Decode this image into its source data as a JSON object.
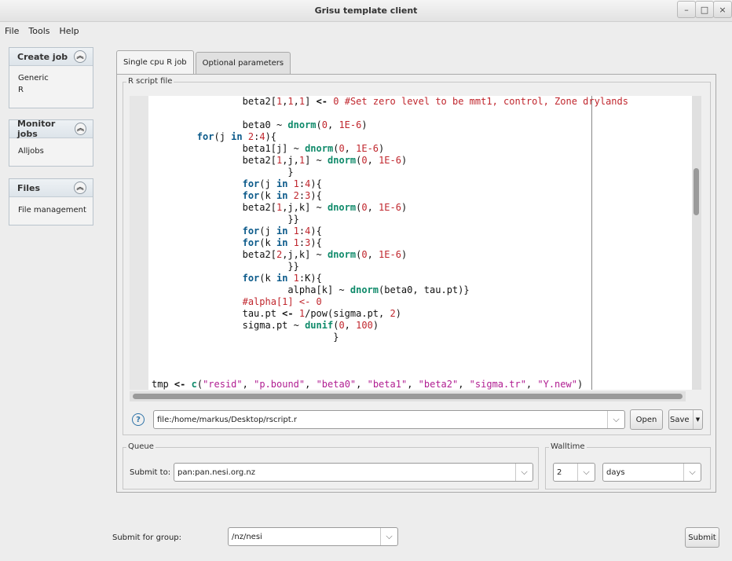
{
  "window": {
    "title": "Grisu template client",
    "controls": [
      "–",
      "□",
      "×"
    ]
  },
  "menu": [
    "File",
    "Tools",
    "Help"
  ],
  "sidebar": {
    "create": {
      "title": "Create job",
      "items": [
        "Generic",
        "R"
      ]
    },
    "monitor": {
      "title": "Monitor jobs",
      "items": [
        "Alljobs"
      ]
    },
    "files": {
      "title": "Files",
      "items": [
        "File management"
      ]
    }
  },
  "tabs": [
    "Single cpu R job",
    "Optional parameters"
  ],
  "script": {
    "legend": "R script file",
    "lines": [
      "                beta2[1,1,1] <- 0 #Set zero level to be mmt1, control, Zone drylands",
      "",
      "                beta0 ~ dnorm(0, 1E-6)",
      "        for(j in 2:4){",
      "                beta1[j] ~ dnorm(0, 1E-6)",
      "                beta2[1,j,1] ~ dnorm(0, 1E-6)",
      "                        }",
      "                for(j in 1:4){",
      "                for(k in 2:3){",
      "                beta2[1,j,k] ~ dnorm(0, 1E-6)",
      "                        }}",
      "                for(j in 1:4){",
      "                for(k in 1:3){",
      "                beta2[2,j,k] ~ dnorm(0, 1E-6)",
      "                        }}",
      "                for(k in 1:K){",
      "                        alpha[k] ~ dnorm(beta0, tau.pt)}",
      "                #alpha[1] <- 0",
      "                tau.pt <- 1/pow(sigma.pt, 2)",
      "                sigma.pt ~ dunif(0, 100)",
      "                                }",
      "",
      "",
      "",
      "tmp <- c(\"resid\", \"p.bound\", \"beta0\", \"beta1\", \"beta2\", \"sigma.tr\", \"Y.new\")"
    ],
    "file_path": "file:/home/markus/Desktop/rscript.r",
    "open_label": "Open",
    "save_label": "Save",
    "help_icon": "?"
  },
  "queue": {
    "legend": "Queue",
    "label": "Submit to:",
    "value": "pan:pan.nesi.org.nz"
  },
  "walltime": {
    "legend": "Walltime",
    "amount": "2",
    "unit": "days"
  },
  "footer": {
    "group_label": "Submit for group:",
    "group_value": "/nz/nesi",
    "submit_label": "Submit"
  }
}
